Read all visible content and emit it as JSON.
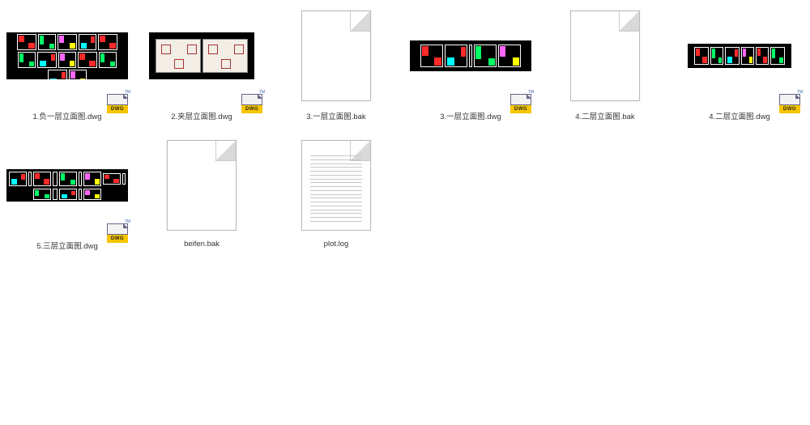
{
  "files": [
    {
      "name": "1.负一层立面图.dwg",
      "kind": "dwg",
      "cad_variant": "a",
      "selected": true
    },
    {
      "name": "2.夹层立面图.dwg",
      "kind": "dwg",
      "cad_variant": "b",
      "selected": false
    },
    {
      "name": "3.一层立面图.bak",
      "kind": "bak",
      "selected": false
    },
    {
      "name": "3.一层立面图.dwg",
      "kind": "dwg",
      "cad_variant": "c",
      "selected": false
    },
    {
      "name": "4.二层立面图.bak",
      "kind": "bak",
      "selected": false
    },
    {
      "name": "4.二层立面图.dwg",
      "kind": "dwg",
      "cad_variant": "d",
      "selected": false
    },
    {
      "name": "5.三层立面图.dwg",
      "kind": "dwg",
      "cad_variant": "e",
      "selected": true
    },
    {
      "name": "beifen.bak",
      "kind": "bak",
      "selected": false
    },
    {
      "name": "plot.log",
      "kind": "log",
      "selected": false
    }
  ],
  "dwg_badge_text": "DWG"
}
